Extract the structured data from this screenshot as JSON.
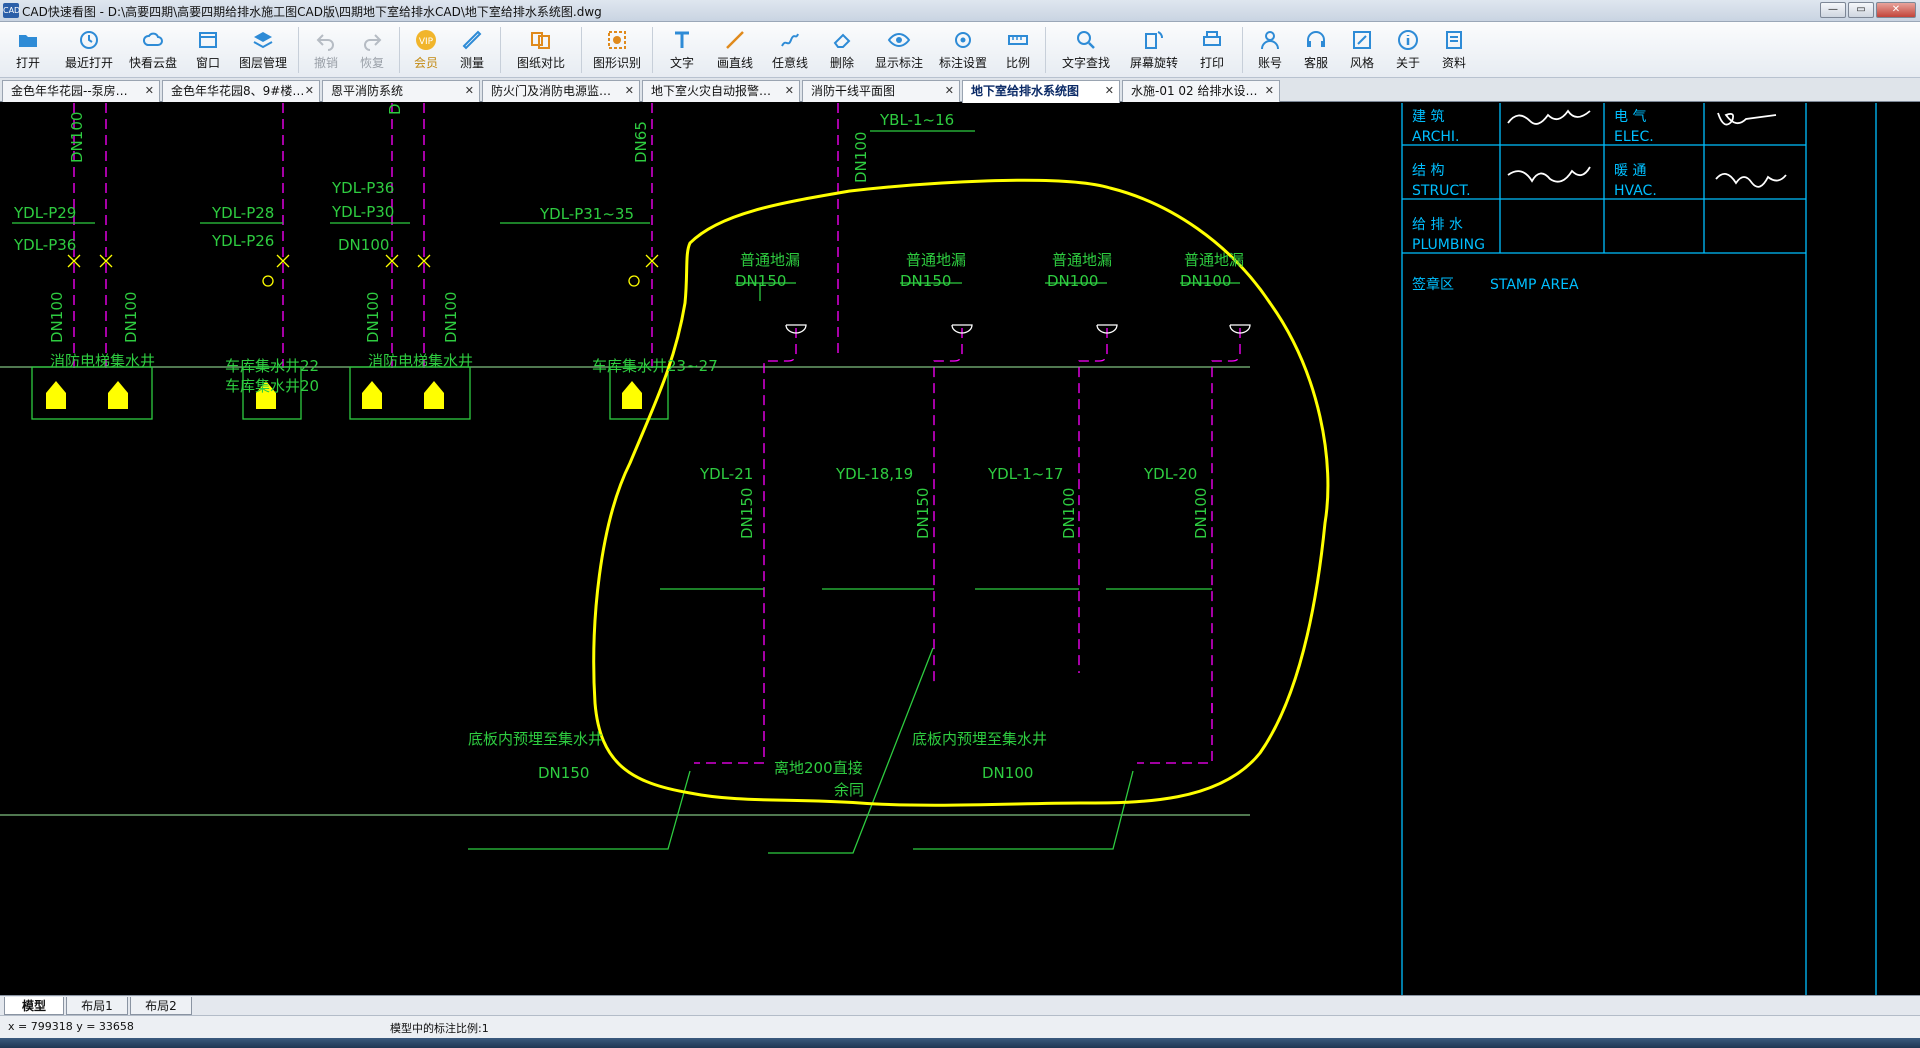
{
  "window": {
    "app_name": "CAD快速看图",
    "title": "CAD快速看图 - D:\\高要四期\\高要四期给排水施工图CAD版\\四期地下室给排水CAD\\地下室给排水系统图.dwg",
    "controls": [
      "—",
      "▭",
      "✕"
    ]
  },
  "toolbar": [
    {
      "label": "打开",
      "icon": "folder-open-icon"
    },
    {
      "label": "最近打开",
      "icon": "recent-icon"
    },
    {
      "label": "快看云盘",
      "icon": "cloud-icon"
    },
    {
      "label": "窗口",
      "icon": "window-icon"
    },
    {
      "label": "图层管理",
      "icon": "layers-icon"
    },
    {
      "label": "撤销",
      "icon": "undo-icon",
      "disabled": true
    },
    {
      "label": "恢复",
      "icon": "redo-icon",
      "disabled": true
    },
    {
      "label": "会员",
      "icon": "vip-icon",
      "vip": true
    },
    {
      "label": "测量",
      "icon": "measure-icon"
    },
    {
      "label": "图纸对比",
      "icon": "compare-icon"
    },
    {
      "label": "图形识别",
      "icon": "shape-recognize-icon"
    },
    {
      "label": "文字",
      "icon": "text-icon"
    },
    {
      "label": "画直线",
      "icon": "line-icon"
    },
    {
      "label": "任意线",
      "icon": "freehand-icon"
    },
    {
      "label": "删除",
      "icon": "eraser-icon"
    },
    {
      "label": "显示标注",
      "icon": "eye-icon"
    },
    {
      "label": "标注设置",
      "icon": "annotation-settings-icon"
    },
    {
      "label": "比例",
      "icon": "scale-icon"
    },
    {
      "label": "文字查找",
      "icon": "text-search-icon"
    },
    {
      "label": "屏幕旋转",
      "icon": "rotate-icon"
    },
    {
      "label": "打印",
      "icon": "print-icon"
    },
    {
      "label": "账号",
      "icon": "account-icon"
    },
    {
      "label": "客服",
      "icon": "headset-icon"
    },
    {
      "label": "风格",
      "icon": "style-icon"
    },
    {
      "label": "关于",
      "icon": "info-icon"
    },
    {
      "label": "资料",
      "icon": "library-icon"
    }
  ],
  "tabs": [
    {
      "label": "金色年华花园--泵房…",
      "active": false
    },
    {
      "label": "金色年华花园8、9#楼…",
      "active": false
    },
    {
      "label": "恩平消防系统",
      "active": false
    },
    {
      "label": "防火门及消防电源监…",
      "active": false
    },
    {
      "label": "地下室火灾自动报警…",
      "active": false
    },
    {
      "label": "消防干线平面图",
      "active": false
    },
    {
      "label": "地下室给排水系统图",
      "active": true
    },
    {
      "label": "水施-01 02 给排水设…",
      "active": false
    }
  ],
  "drawing": {
    "labels": {
      "dn100_a": "DN100",
      "dn65": "DN65",
      "dn100_b": "DN100",
      "dn_partial": "DN",
      "ybl": "YBL-1~16",
      "ydl_p29": "YDL-P29",
      "ydl_p36a": "YDL-P36",
      "ydl_p28": "YDL-P28",
      "ydl_p26": "YDL-P26",
      "ydl_p36b": "YDL-P36",
      "ydl_p30": "YDL-P30",
      "dn100_c": "DN100",
      "ydl_p31": "YDL-P31~35",
      "dn100_v1": "DN100",
      "dn100_v2": "DN100",
      "dn100_v3": "DN100",
      "dn100_v4": "DN100",
      "floor_drain_1": "普通地漏",
      "floor_drain_2": "普通地漏",
      "floor_drain_3": "普通地漏",
      "floor_drain_4": "普通地漏",
      "fd_dn_1": "DN150",
      "fd_dn_2": "DN150",
      "fd_dn_3": "DN100",
      "fd_dn_4": "DN100",
      "pit_fire_elev_1": "消防电梯集水井",
      "pit_garage_22": "车库集水井22",
      "pit_garage_20": "车库集水井20",
      "pit_fire_elev_2": "消防电梯集水井",
      "pit_garage_23": "车库集水井23~27",
      "ydl_21": "YDL-21",
      "ydl_18": "YDL-18,19",
      "ydl_1": "YDL-1~17",
      "ydl_20": "YDL-20",
      "riser_dn_1": "DN150",
      "riser_dn_2": "DN150",
      "riser_dn_3": "DN100",
      "riser_dn_4": "DN100",
      "bottom_left_note": "底板内预埋至集水井",
      "bottom_left_dn": "DN150",
      "bottom_mid_note": "离地200直接",
      "bottom_mid_note2": "余同",
      "bottom_right_note": "底板内预埋至集水井",
      "bottom_right_dn": "DN100"
    },
    "title_block": {
      "arch_cn": "建    筑",
      "arch_en": "ARCHI.",
      "elec_cn": "电    气",
      "elec_en": "ELEC.",
      "struct_cn": "结    构",
      "struct_en": "STRUCT.",
      "hvac_cn": "暖    通",
      "hvac_en": "HVAC.",
      "plumb_cn": "给 排 水",
      "plumb_en": "PLUMBING",
      "stamp_cn": "签章区",
      "stamp_en": "STAMP AREA"
    },
    "colors": {
      "green": "#2ecc40",
      "yellow": "#ffff00",
      "magenta": "#ff00ff",
      "cyan": "#00bfff",
      "white": "#ffffff",
      "gray_green": "#7fbf7f"
    }
  },
  "layout_tabs": [
    {
      "label": "模型",
      "active": true
    },
    {
      "label": "布局1",
      "active": false
    },
    {
      "label": "布局2",
      "active": false
    }
  ],
  "status": {
    "coords": "x = 799318  y = 33658",
    "scale_text": "模型中的标注比例:1"
  }
}
